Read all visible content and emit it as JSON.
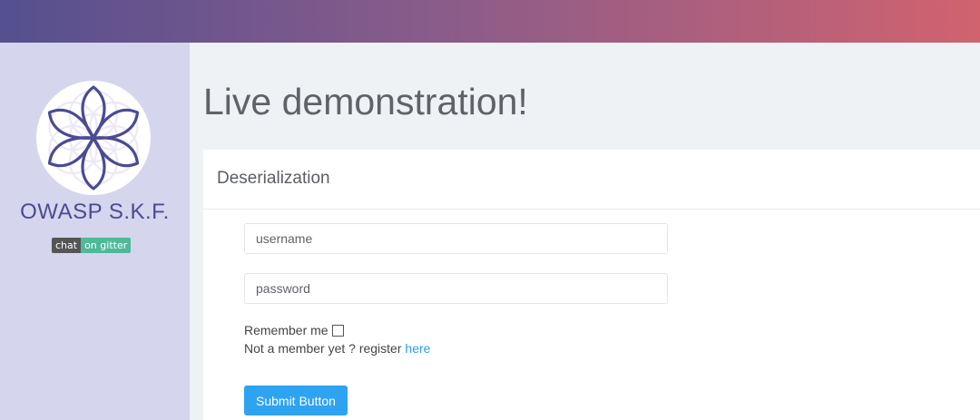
{
  "brand": {
    "name": "OWASP S.K.F.",
    "badge_left": "chat",
    "badge_right": "on gitter"
  },
  "colors": {
    "sidebar_bg": "#d6d5ee",
    "brand_text": "#4a4b92",
    "link": "#2d9ee8",
    "button_bg": "#2ea3f2",
    "topbar_gradient_start": "#55508f",
    "topbar_gradient_end": "#d1636f"
  },
  "icons": {
    "logo": "flower-of-life-icon",
    "checkbox": "checkbox-icon"
  },
  "main": {
    "title": "Live demonstration!",
    "card_title": "Deserialization"
  },
  "form": {
    "username_placeholder": "username",
    "password_placeholder": "password",
    "remember_label": "Remember me",
    "register_text": "Not a member yet ? register",
    "register_link": "here",
    "submit_label": "Submit Button"
  }
}
